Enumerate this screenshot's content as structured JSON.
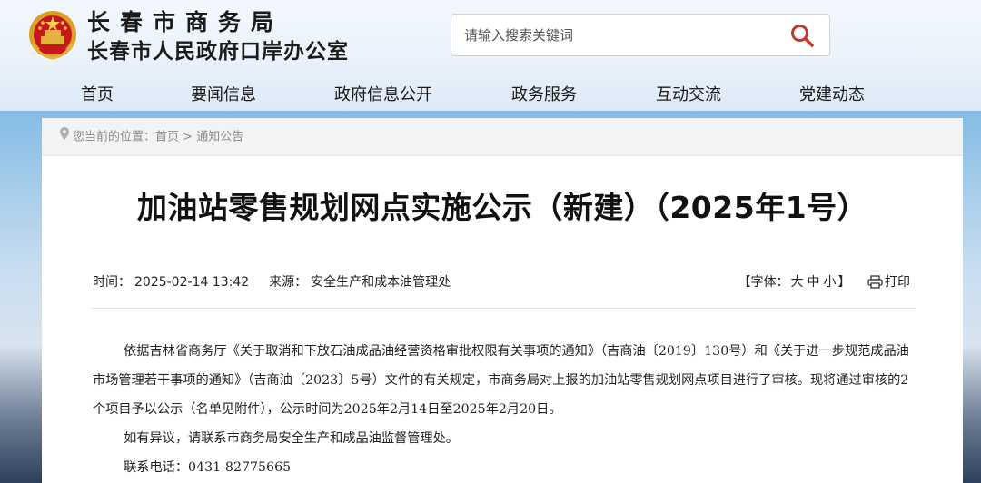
{
  "header": {
    "org_name": "长春市商务局",
    "org_subname": "长春市人民政府口岸办公室",
    "emblem_icon": "national-emblem-icon",
    "search": {
      "placeholder": "请输入搜索关键词",
      "icon": "search-icon"
    }
  },
  "nav": {
    "items": [
      {
        "label": "首页"
      },
      {
        "label": "要闻信息"
      },
      {
        "label": "政府信息公开"
      },
      {
        "label": "政务服务"
      },
      {
        "label": "互动交流"
      },
      {
        "label": "党建动态"
      }
    ]
  },
  "breadcrumb": {
    "prefix": "您当前的位置：",
    "home": "首页",
    "separator": ">",
    "current": "通知公告"
  },
  "article": {
    "title": "加油站零售规划网点实施公示（新建）（2025年1号）",
    "time_label": "时间：",
    "time_value": "2025-02-14 13:42",
    "source_label": "来源：",
    "source_value": "安全生产和成本油管理处",
    "font_label": "【字体：",
    "font_large": "大",
    "font_medium": "中",
    "font_small": "小",
    "font_close": "】",
    "print_label": "打印",
    "paragraphs": [
      "依据吉林省商务厅《关于取消和下放石油成品油经营资格审批权限有关事项的通知》（吉商油〔2019〕130号）和《关于进一步规范成品油市场管理若干事项的通知》（吉商油〔2023〕5号）文件的有关规定，市商务局对上报的加油站零售规划网点项目进行了审核。现将通过审核的2个项目予以公示（名单见附件），公示时间为2025年2月14日至2025年2月20日。",
      "如有异议，请联系市商务局安全生产和成品油监督管理处。",
      "联系电话：0431-82775665"
    ]
  },
  "colors": {
    "header_bg": "#e8f1fa",
    "search_icon": "#c0392b",
    "title_text": "#111111",
    "breadcrumb_bg": "#f3f3f3"
  }
}
